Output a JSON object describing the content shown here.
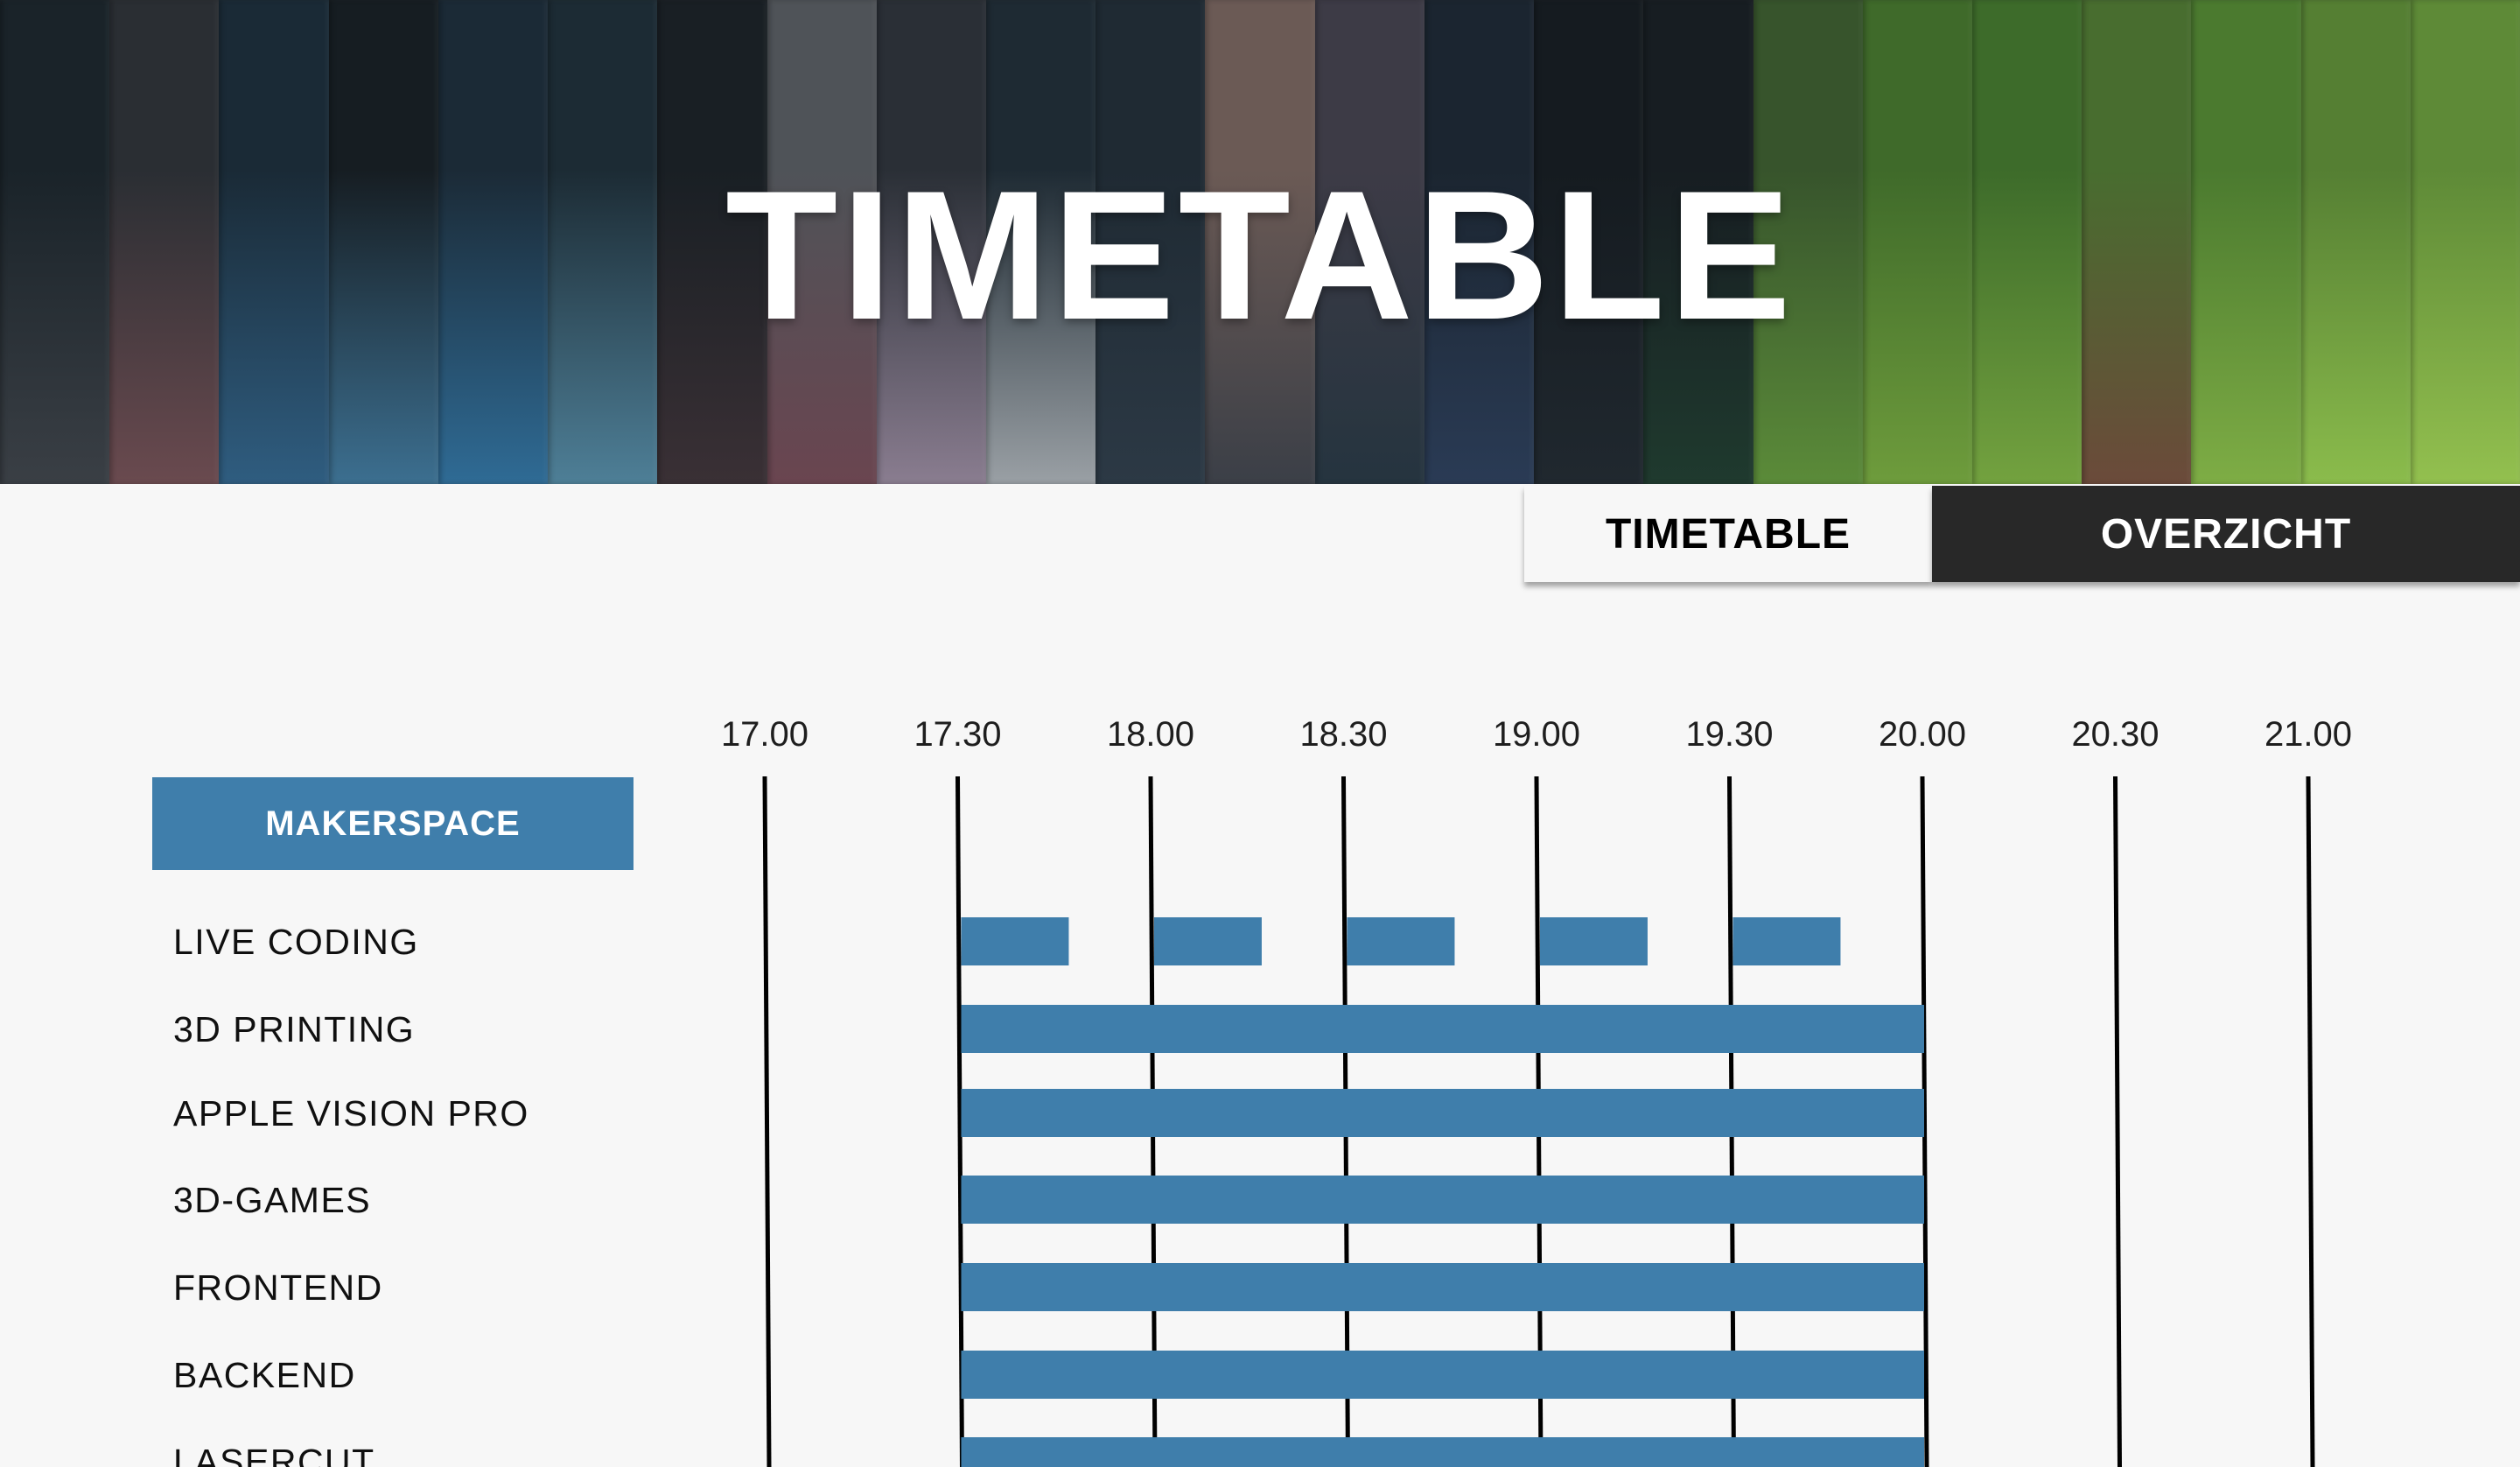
{
  "banner": {
    "title": "TIMETABLE",
    "stripe_colors": [
      [
        "#1a2329",
        "#3a3f45"
      ],
      [
        "#2a2e33",
        "#6a4a4f"
      ],
      [
        "#1a2a36",
        "#2f5d80"
      ],
      [
        "#161d22",
        "#3c6f90"
      ],
      [
        "#1b2a36",
        "#2f6b95"
      ],
      [
        "#1c2b34",
        "#4e7f97"
      ],
      [
        "#191f24",
        "#3a3035"
      ],
      [
        "#4f5358",
        "#6a4550"
      ],
      [
        "#2a2f36",
        "#8a7d90"
      ],
      [
        "#1e2a33",
        "#9aa0a5"
      ],
      [
        "#1f2a33",
        "#2c3945"
      ],
      [
        "#6b5a55",
        "#3b3f47"
      ],
      [
        "#3d3b46",
        "#25343f"
      ],
      [
        "#1b2530",
        "#2a3b55"
      ],
      [
        "#151b20",
        "#20282f"
      ],
      [
        "#171d22",
        "#1f3a2e"
      ],
      [
        "#37542c",
        "#5b8b39"
      ],
      [
        "#3f6a2a",
        "#6e9c3c"
      ],
      [
        "#3d6b2a",
        "#73a23f"
      ],
      [
        "#486d2f",
        "#6b4a3a"
      ],
      [
        "#4b7a2f",
        "#7ead45"
      ],
      [
        "#557f33",
        "#8bbc4c"
      ],
      [
        "#5e8a37",
        "#93c04f"
      ]
    ]
  },
  "tabs": {
    "timetable": "TIMETABLE",
    "overzicht": "OVERZICHT"
  },
  "category": "MAKERSPACE",
  "chart_data": {
    "type": "gantt",
    "times": [
      "17.00",
      "17.30",
      "18.00",
      "18.30",
      "19.00",
      "19.30",
      "20.00",
      "20.30",
      "21.00"
    ],
    "rows": [
      {
        "label": "LIVE CODING",
        "sessions": [
          [
            "17.30",
            "17.47"
          ],
          [
            "18.00",
            "18.17"
          ],
          [
            "18.30",
            "18.47"
          ],
          [
            "19.00",
            "19.17"
          ],
          [
            "19.30",
            "19.47"
          ]
        ]
      },
      {
        "label": "3D PRINTING",
        "sessions": [
          [
            "17.30",
            "20.00"
          ]
        ]
      },
      {
        "label": "APPLE VISION PRO",
        "sessions": [
          [
            "17.30",
            "20.00"
          ]
        ]
      },
      {
        "label": "3D-GAMES",
        "sessions": [
          [
            "17.30",
            "20.00"
          ]
        ]
      },
      {
        "label": "FRONTEND",
        "sessions": [
          [
            "17.30",
            "20.00"
          ]
        ]
      },
      {
        "label": "BACKEND",
        "sessions": [
          [
            "17.30",
            "20.00"
          ]
        ]
      },
      {
        "label": "LASERCUT",
        "sessions": [
          [
            "17.30",
            "20.00"
          ]
        ]
      }
    ]
  }
}
